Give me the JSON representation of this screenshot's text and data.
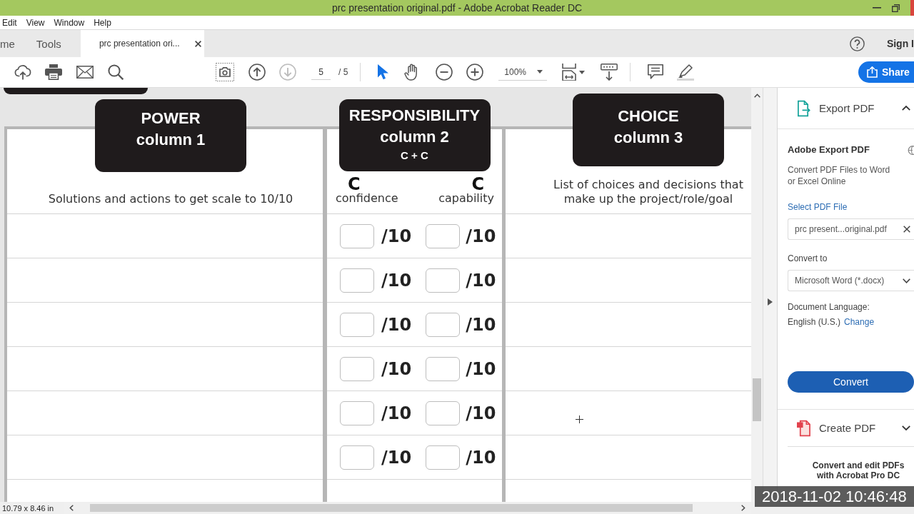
{
  "window": {
    "title": "prc presentation original.pdf - Adobe Acrobat Reader DC"
  },
  "menu": [
    "Edit",
    "View",
    "Window",
    "Help"
  ],
  "tabs": [
    {
      "label": "me",
      "selected": false,
      "closable": false
    },
    {
      "label": "Tools",
      "selected": false,
      "closable": false
    },
    {
      "label": "prc presentation ori...",
      "selected": true,
      "closable": true
    }
  ],
  "account": {
    "sign_in": "Sign I"
  },
  "toolbar": {
    "page_buttons": [
      {
        "disabled": false
      },
      {
        "disabled": true
      }
    ],
    "page_number": "5",
    "page_total": "/ 5",
    "pointer_tools": [
      {
        "selected": true
      },
      {
        "selected": false
      }
    ],
    "zoom": "100%",
    "share": "Share"
  },
  "document": {
    "columns": [
      {
        "title": "POWER",
        "subtitle": "column 1",
        "description": "Solutions and actions to get scale to 10/10"
      },
      {
        "title": "RESPONSIBILITY",
        "subtitle": "column 2",
        "note": "C + C",
        "measures": [
          {
            "letter": "C",
            "label": "confidence"
          },
          {
            "letter": "C",
            "label": "capability"
          }
        ]
      },
      {
        "title": "CHOICE",
        "subtitle": "column 3",
        "description": "List of choices and decisions that make up the project/role/goal"
      }
    ],
    "rows": [
      {
        "scores": [
          "/10",
          "/10"
        ]
      },
      {
        "scores": [
          "/10",
          "/10"
        ]
      },
      {
        "scores": [
          "/10",
          "/10"
        ]
      },
      {
        "scores": [
          "/10",
          "/10"
        ]
      },
      {
        "scores": [
          "/10",
          "/10"
        ]
      },
      {
        "scores": [
          "/10",
          "/10"
        ]
      }
    ]
  },
  "tools_pane": {
    "export_pdf": {
      "title": "Export PDF",
      "expanded": true,
      "heading": "Adobe Export PDF",
      "description": "Convert PDF Files to Word or Excel Online",
      "select_link": "Select PDF File",
      "file": "prc present...original.pdf",
      "convert_to_label": "Convert to",
      "format": "Microsoft Word (*.docx)",
      "language_label": "Document Language:",
      "language": "English (U.S.)",
      "change_link": "Change",
      "convert_button": "Convert"
    },
    "create_pdf": {
      "title": "Create PDF",
      "expanded": false
    },
    "promo": "Convert and edit PDFs with Acrobat Pro DC"
  },
  "status_bar": {
    "page_size": "10.79 x 8.46 in"
  },
  "recording_overlay": {
    "timestamp": "2018-11-02 10:46:48"
  }
}
